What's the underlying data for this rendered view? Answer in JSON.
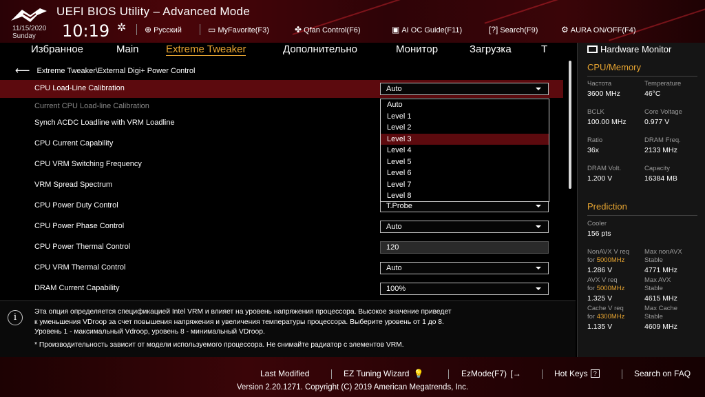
{
  "app": {
    "title": "UEFI BIOS Utility – Advanced Mode"
  },
  "clock": {
    "date": "11/15/2020",
    "day": "Sunday",
    "time": "10:19"
  },
  "toolbar": [
    {
      "icon": "globe-icon",
      "label": "Русский"
    },
    {
      "icon": "favorite-icon",
      "label": "MyFavorite(F3)"
    },
    {
      "icon": "fan-icon",
      "label": "Qfan Control(F6)"
    },
    {
      "icon": "chip-icon",
      "label": "AI OC Guide(F11)"
    },
    {
      "icon": "search-icon",
      "label": "Search(F9)"
    },
    {
      "icon": "aura-icon",
      "label": "AURA ON/OFF(F4)"
    }
  ],
  "tabs": [
    "Избранное",
    "Main",
    "Extreme Tweaker",
    "Дополнительно",
    "Монитор",
    "Загрузка",
    "T"
  ],
  "active_tab": "Extreme Tweaker",
  "breadcrumb": "Extreme Tweaker\\External Digi+ Power Control",
  "settings": [
    {
      "label": "CPU Load-Line Calibration",
      "value": "Auto",
      "type": "dropdown"
    },
    {
      "label": "Current CPU Load-line Calibration",
      "value": "",
      "type": "readonly"
    },
    {
      "label": "Synch ACDC Loadline with VRM Loadline",
      "value": "",
      "type": "hidden"
    },
    {
      "label": "CPU Current Capability",
      "value": "",
      "type": "hidden"
    },
    {
      "label": "CPU VRM Switching Frequency",
      "value": "",
      "type": "hidden"
    },
    {
      "label": "VRM Spread Spectrum",
      "value": "",
      "type": "hidden"
    },
    {
      "label": "CPU Power Duty Control",
      "value": "T.Probe",
      "type": "dropdown"
    },
    {
      "label": "CPU Power Phase Control",
      "value": "Auto",
      "type": "dropdown"
    },
    {
      "label": "CPU Power Thermal Control",
      "value": "120",
      "type": "input"
    },
    {
      "label": "CPU VRM Thermal Control",
      "value": "Auto",
      "type": "dropdown"
    },
    {
      "label": "DRAM Current Capability",
      "value": "100%",
      "type": "dropdown"
    }
  ],
  "dropdown_menu": {
    "options": [
      "Auto",
      "Level 1",
      "Level 2",
      "Level 3",
      "Level 4",
      "Level 5",
      "Level 6",
      "Level 7",
      "Level 8"
    ],
    "highlighted": "Level 3"
  },
  "help": {
    "lines": [
      "Эта опция определяется спецификацией Intel VRM и влияет на уровень напряжения процессора. Высокое значение приведет",
      "к уменьшения VDroop за счет повышения напряжения и увеличения температуры процессора. Выберите уровень от 1 до 8.",
      "Уровень 1 - максимальный Vdroop, уровень 8 - минимальный VDroop.",
      "* Производительность зависит от модели используемого процессора. Не снимайте радиатор с элементов VRM."
    ]
  },
  "hardware_monitor": {
    "title": "Hardware Monitor",
    "cpu_memory": {
      "title": "CPU/Memory",
      "items": [
        {
          "label": "Частота",
          "value": "3600 MHz"
        },
        {
          "label": "Temperature",
          "value": "46°C"
        },
        {
          "label": "BCLK",
          "value": "100.00 MHz"
        },
        {
          "label": "Core Voltage",
          "value": "0.977 V"
        },
        {
          "label": "Ratio",
          "value": "36x"
        },
        {
          "label": "DRAM Freq.",
          "value": "2133 MHz"
        },
        {
          "label": "DRAM Volt.",
          "value": "1.200 V"
        },
        {
          "label": "Capacity",
          "value": "16384 MB"
        }
      ]
    },
    "prediction": {
      "title": "Prediction",
      "cooler_label": "Cooler",
      "cooler_value": "156 pts",
      "items": [
        {
          "label1": "NonAVX V req",
          "label2a": "for ",
          "label2b": "5000MHz",
          "value": "1.286 V"
        },
        {
          "label1": "Max nonAVX",
          "label2a": "Stable",
          "label2b": "",
          "value": "4771 MHz"
        },
        {
          "label1": "AVX V req",
          "label2a": "for ",
          "label2b": "5000MHz",
          "value": "1.325 V"
        },
        {
          "label1": "Max AVX",
          "label2a": "Stable",
          "label2b": "",
          "value": "4615 MHz"
        },
        {
          "label1": "Cache V req",
          "label2a": "for ",
          "label2b": "4300MHz",
          "value": "1.135 V"
        },
        {
          "label1": "Max Cache",
          "label2a": "Stable",
          "label2b": "",
          "value": "4609 MHz"
        }
      ]
    }
  },
  "footer": {
    "buttons": [
      "Last Modified",
      "EZ Tuning Wizard",
      "EzMode(F7)",
      "Hot Keys",
      "Search on FAQ"
    ],
    "hotkeys_key": "?",
    "version": "Version 2.20.1271. Copyright (C) 2019 American Megatrends, Inc."
  },
  "colors": {
    "accent": "#e8a531",
    "selection": "#5c0a0e",
    "header_red": "#4a0509"
  }
}
